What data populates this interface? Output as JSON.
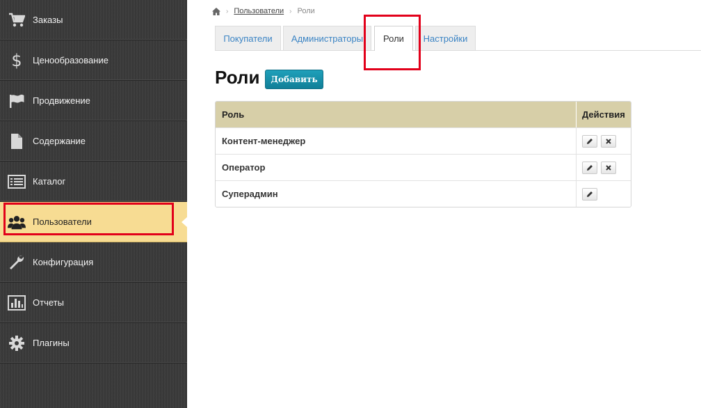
{
  "sidebar": {
    "items": [
      {
        "label": "Заказы",
        "icon": "cart-icon"
      },
      {
        "label": "Ценообразование",
        "icon": "dollar-icon"
      },
      {
        "label": "Продвижение",
        "icon": "flag-icon"
      },
      {
        "label": "Содержание",
        "icon": "document-icon"
      },
      {
        "label": "Каталог",
        "icon": "list-icon"
      },
      {
        "label": "Пользователи",
        "icon": "users-icon",
        "active": true
      },
      {
        "label": "Конфигурация",
        "icon": "wrench-icon"
      },
      {
        "label": "Отчеты",
        "icon": "bar-chart-icon"
      },
      {
        "label": "Плагины",
        "icon": "gear-icon"
      }
    ]
  },
  "breadcrumb": {
    "parent": "Пользователи",
    "current": "Роли"
  },
  "tabs": [
    {
      "label": "Покупатели"
    },
    {
      "label": "Администраторы"
    },
    {
      "label": "Роли",
      "active": true
    },
    {
      "label": "Настройки"
    }
  ],
  "page": {
    "title": "Роли",
    "add_label": "Добавить"
  },
  "table": {
    "columns": [
      "Роль",
      "Действия"
    ],
    "rows": [
      {
        "role": "Контент-менеджер",
        "actions": [
          "edit",
          "delete"
        ]
      },
      {
        "role": "Оператор",
        "actions": [
          "edit",
          "delete"
        ]
      },
      {
        "role": "Суперадмин",
        "actions": [
          "edit"
        ]
      }
    ]
  },
  "colors": {
    "sidebar_bg": "#3a3a3a",
    "active_item": "#f7dc93",
    "accent_button": "#1a93ad",
    "table_header": "#d7cfa8",
    "highlight": "#e2001a",
    "tab_link": "#3b84c4"
  }
}
